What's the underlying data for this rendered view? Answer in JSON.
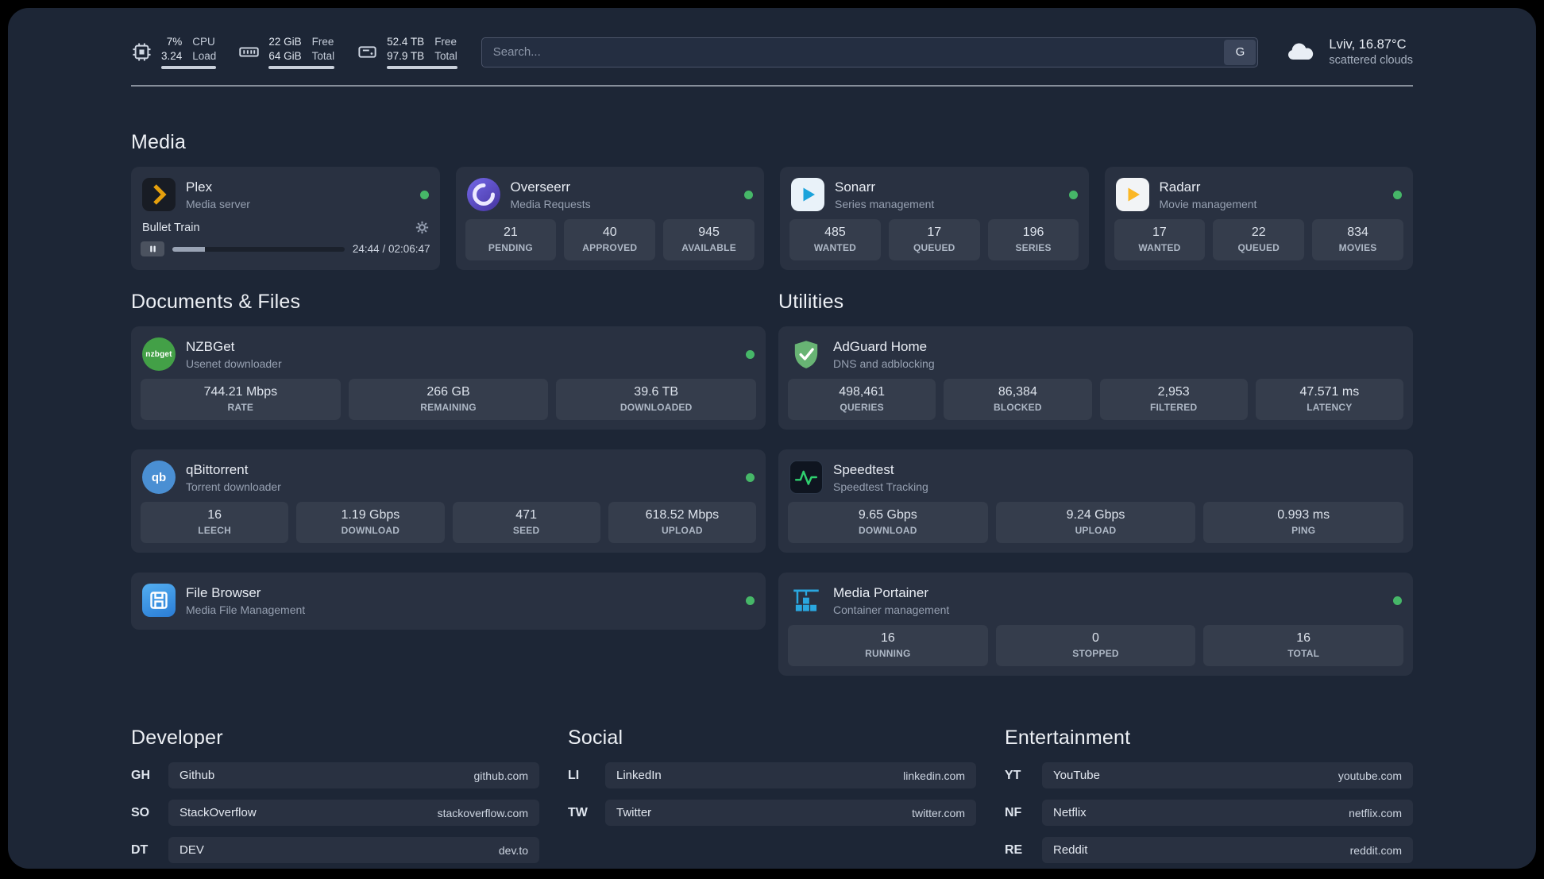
{
  "theme": {
    "page_bg": "#000000",
    "panel_bg": "#1d2636",
    "status_green": "#46b768",
    "plex_amber": "#e5a00d",
    "sonarr_blue": "#1ba3db",
    "radarr_yellow": "#fbb726",
    "nzbget_green": "#43a047",
    "qbittorrent_blue": "#4a8fd3",
    "adguard_green": "#68b474",
    "speedtest_green": "#2fd06f",
    "portainer_blue": "#2aa7df"
  },
  "topbar": {
    "resources": [
      {
        "icon": "cpu-icon",
        "rows": [
          {
            "value": "7%",
            "label": "CPU"
          },
          {
            "value": "3.24",
            "label": "Load"
          }
        ]
      },
      {
        "icon": "memory-icon",
        "rows": [
          {
            "value": "22 GiB",
            "label": "Free"
          },
          {
            "value": "64 GiB",
            "label": "Total"
          }
        ]
      },
      {
        "icon": "disk-icon",
        "rows": [
          {
            "value": "52.4 TB",
            "label": "Free"
          },
          {
            "value": "97.9 TB",
            "label": "Total"
          }
        ]
      }
    ],
    "search": {
      "placeholder": "Search...",
      "button": "G"
    },
    "weather": {
      "icon": "cloud-icon",
      "location": "Lviv, 16.87°C",
      "condition": "scattered clouds"
    }
  },
  "sections": {
    "media": {
      "title": "Media",
      "services": [
        {
          "icon": "plex-icon",
          "name": "Plex",
          "description": "Media server",
          "online": true,
          "player": {
            "title": "Bullet Train",
            "time": "24:44 / 02:06:47"
          }
        },
        {
          "icon": "overseerr-icon",
          "name": "Overseerr",
          "description": "Media Requests",
          "online": true,
          "stats": [
            {
              "value": "21",
              "label": "PENDING"
            },
            {
              "value": "40",
              "label": "APPROVED"
            },
            {
              "value": "945",
              "label": "AVAILABLE"
            }
          ]
        },
        {
          "icon": "sonarr-icon",
          "name": "Sonarr",
          "description": "Series management",
          "online": true,
          "stats": [
            {
              "value": "485",
              "label": "WANTED"
            },
            {
              "value": "17",
              "label": "QUEUED"
            },
            {
              "value": "196",
              "label": "SERIES"
            }
          ]
        },
        {
          "icon": "radarr-icon",
          "name": "Radarr",
          "description": "Movie management",
          "online": true,
          "stats": [
            {
              "value": "17",
              "label": "WANTED"
            },
            {
              "value": "22",
              "label": "QUEUED"
            },
            {
              "value": "834",
              "label": "MOVIES"
            }
          ]
        }
      ]
    },
    "documents": {
      "title": "Documents & Files",
      "services": [
        {
          "icon": "nzbget-icon",
          "icon_text": "nzbget",
          "name": "NZBGet",
          "description": "Usenet downloader",
          "online": true,
          "stats": [
            {
              "value": "744.21 Mbps",
              "label": "RATE"
            },
            {
              "value": "266 GB",
              "label": "REMAINING"
            },
            {
              "value": "39.6 TB",
              "label": "DOWNLOADED"
            }
          ]
        },
        {
          "icon": "qbittorrent-icon",
          "icon_text": "qb",
          "name": "qBittorrent",
          "description": "Torrent downloader",
          "online": true,
          "stats": [
            {
              "value": "16",
              "label": "LEECH"
            },
            {
              "value": "1.19 Gbps",
              "label": "DOWNLOAD"
            },
            {
              "value": "471",
              "label": "SEED"
            },
            {
              "value": "618.52 Mbps",
              "label": "UPLOAD"
            }
          ]
        },
        {
          "icon": "filebrowser-icon",
          "name": "File Browser",
          "description": "Media File Management",
          "online": true,
          "stats": []
        }
      ]
    },
    "utilities": {
      "title": "Utilities",
      "services": [
        {
          "icon": "adguard-icon",
          "name": "AdGuard Home",
          "description": "DNS and adblocking",
          "online": false,
          "stats": [
            {
              "value": "498,461",
              "label": "QUERIES"
            },
            {
              "value": "86,384",
              "label": "BLOCKED"
            },
            {
              "value": "2,953",
              "label": "FILTERED"
            },
            {
              "value": "47.571 ms",
              "label": "LATENCY"
            }
          ]
        },
        {
          "icon": "speedtest-icon",
          "name": "Speedtest",
          "description": "Speedtest Tracking",
          "online": false,
          "stats": [
            {
              "value": "9.65 Gbps",
              "label": "DOWNLOAD"
            },
            {
              "value": "9.24 Gbps",
              "label": "UPLOAD"
            },
            {
              "value": "0.993 ms",
              "label": "PING"
            }
          ]
        },
        {
          "icon": "portainer-icon",
          "name": "Media Portainer",
          "description": "Container management",
          "online": true,
          "stats": [
            {
              "value": "16",
              "label": "RUNNING"
            },
            {
              "value": "0",
              "label": "STOPPED"
            },
            {
              "value": "16",
              "label": "TOTAL"
            }
          ]
        }
      ]
    }
  },
  "bookmarks": [
    {
      "title": "Developer",
      "items": [
        {
          "abbr": "GH",
          "name": "Github",
          "url": "github.com"
        },
        {
          "abbr": "SO",
          "name": "StackOverflow",
          "url": "stackoverflow.com"
        },
        {
          "abbr": "DT",
          "name": "DEV",
          "url": "dev.to"
        }
      ]
    },
    {
      "title": "Social",
      "items": [
        {
          "abbr": "LI",
          "name": "LinkedIn",
          "url": "linkedin.com"
        },
        {
          "abbr": "TW",
          "name": "Twitter",
          "url": "twitter.com"
        }
      ]
    },
    {
      "title": "Entertainment",
      "items": [
        {
          "abbr": "YT",
          "name": "YouTube",
          "url": "youtube.com"
        },
        {
          "abbr": "NF",
          "name": "Netflix",
          "url": "netflix.com"
        },
        {
          "abbr": "RE",
          "name": "Reddit",
          "url": "reddit.com"
        }
      ]
    }
  ]
}
